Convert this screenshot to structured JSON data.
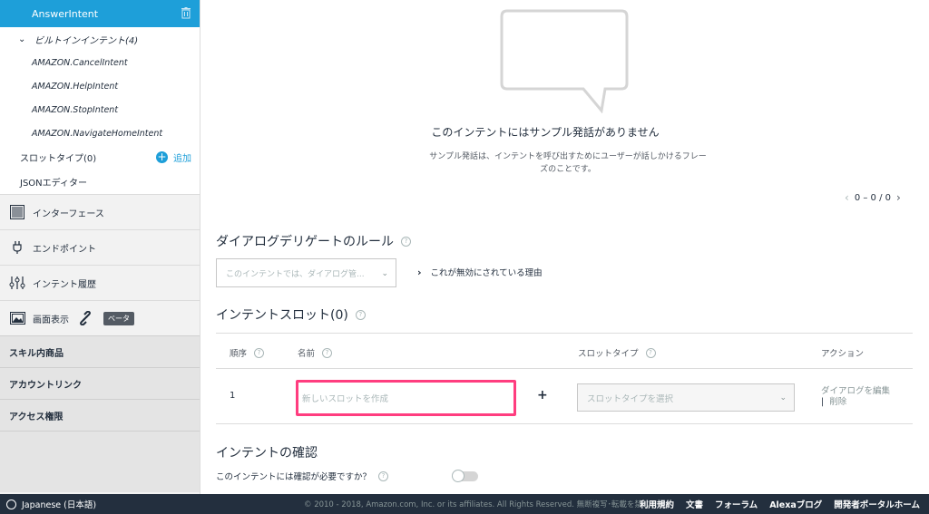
{
  "sidebar": {
    "active_intent": "AnswerIntent",
    "builtin_group": "ビルトインインテント(4)",
    "builtin_items": [
      "AMAZON.CancelIntent",
      "AMAZON.HelpIntent",
      "AMAZON.StopIntent",
      "AMAZON.NavigateHomeIntent"
    ],
    "slot_types": "スロットタイプ(0)",
    "add_label": "追加",
    "json_editor": "JSONエディター",
    "nav": {
      "interface": "インターフェース",
      "endpoint": "エンドポイント",
      "intent_history": "インテント履歴",
      "display": "画面表示",
      "beta": "ベータ"
    },
    "sections": {
      "isp": "スキル内商品",
      "account_linking": "アカウントリンク",
      "permissions": "アクセス権限"
    }
  },
  "empty_state": {
    "title": "このインテントにはサンプル発話がありません",
    "desc": "サンプル発話は、インテントを呼び出すためにユーザーが話しかけるフレーズのことです。"
  },
  "pager": {
    "text": "0 – 0 / 0"
  },
  "dialog_delegate": {
    "title": "ダイアログデリゲートのルール",
    "dropdown_placeholder": "このインテントでは、ダイアログ管...",
    "reason_link": "これが無効にされている理由"
  },
  "slots": {
    "title": "インテントスロット(0)",
    "headers": {
      "order": "順序",
      "name": "名前",
      "slot_type": "スロットタイプ",
      "action": "アクション"
    },
    "row": {
      "order": "1",
      "name_placeholder": "新しいスロットを作成",
      "type_placeholder": "スロットタイプを選択",
      "edit_dialog": "ダイアログを編集",
      "delete": "削除"
    }
  },
  "confirmation": {
    "title": "インテントの確認",
    "question": "このインテントには確認が必要ですか？"
  },
  "footer": {
    "language": "Japanese (日本語)",
    "copyright": "© 2010 - 2018, Amazon.com, Inc. or its affiliates. All Rights Reserved. 無断複写･転載を禁じます",
    "links": [
      "利用規約",
      "文書",
      "フォーラム",
      "Alexaブログ",
      "開発者ポータルホーム"
    ]
  },
  "colors": {
    "accent": "#1e9fd9",
    "highlight": "#ff3d7f",
    "footer_bg": "#232f3e"
  }
}
